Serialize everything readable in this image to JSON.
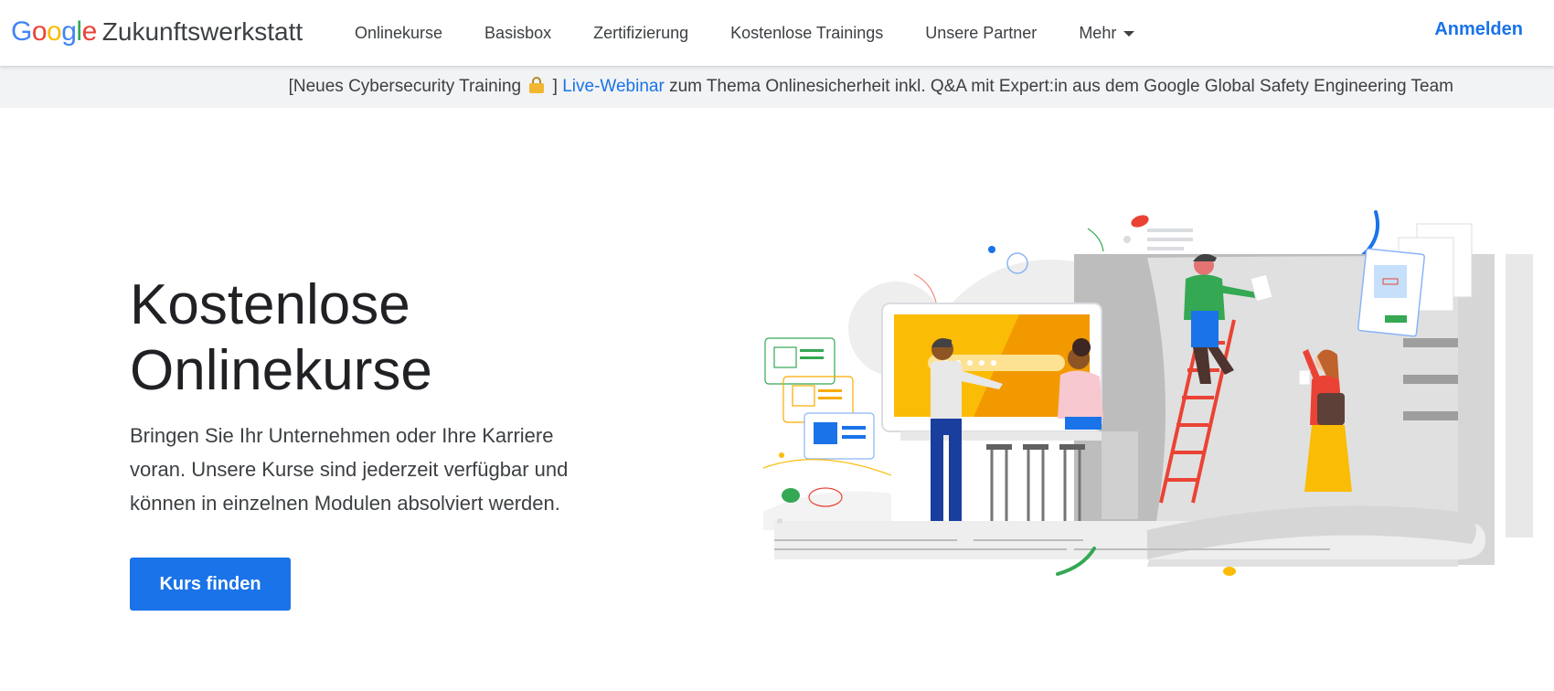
{
  "header": {
    "logo_google": "Google",
    "logo_product": "Zukunftswerkstatt",
    "nav": [
      {
        "label": "Onlinekurse"
      },
      {
        "label": "Basisbox"
      },
      {
        "label": "Zertifizierung"
      },
      {
        "label": "Kostenlose Trainings"
      },
      {
        "label": "Unsere Partner"
      },
      {
        "label": "Mehr"
      }
    ],
    "signin_label": "Anmelden"
  },
  "banner": {
    "prefix": "[Neues Cybersecurity Training ",
    "lock_glyph": "lock-icon",
    "bracket_close": " ] ",
    "link_label": "Live-Webinar",
    "suffix": " zum Thema Onlinesicherheit inkl. Q&A mit Expert:in aus dem Google Global Safety Engineering Team"
  },
  "hero": {
    "title_line1": "Kostenlose",
    "title_line2": "Onlinekurse",
    "description": "Bringen Sie Ihr Unternehmen oder Ihre Karriere voran. Unsere Kurse sind jederzeit verfügbar und können in einzelnen Modulen absolviert werden.",
    "cta_label": "Kurs finden"
  },
  "colors": {
    "accent": "#1a73e8",
    "google_blue": "#4285f4",
    "google_red": "#ea4335",
    "google_yellow": "#fbbc05",
    "google_green": "#34a853"
  }
}
